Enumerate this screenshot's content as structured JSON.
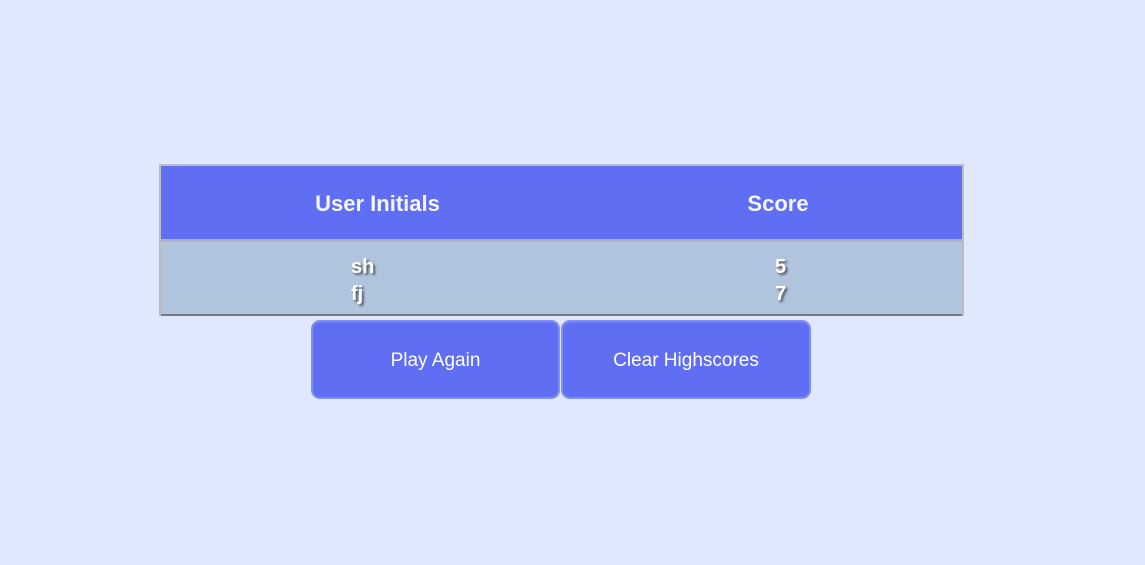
{
  "table": {
    "headers": {
      "initials": "User Initials",
      "score": "Score"
    },
    "rows": [
      {
        "initials": "sh",
        "score": "5"
      },
      {
        "initials": "fj",
        "score": "7"
      }
    ]
  },
  "actions": {
    "play_again": "Play Again",
    "clear_highscores": "Clear Highscores"
  },
  "colors": {
    "page_background": "#e0e8fd",
    "header_background": "#5f6ef2",
    "body_background": "#b0c4de",
    "button_background": "#5f6ef2",
    "text": "#ffffff"
  }
}
